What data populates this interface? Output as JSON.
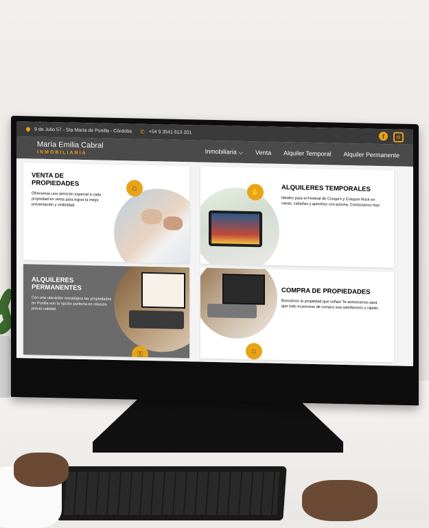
{
  "topbar": {
    "address": "9 de Julio 57 - Sta María de Punilla - Córdoba",
    "phone": "+54 9 3541 613 201",
    "social": [
      {
        "icon": "facebook-icon"
      },
      {
        "icon": "instagram-icon"
      }
    ]
  },
  "brand": {
    "name": "María Emilia Cabral",
    "subtitle": "INMOBILIARIA"
  },
  "nav": {
    "items": [
      "Inmobiliaria ⌵",
      "Venta",
      "Alquiler Temporal",
      "Alquiler Permanente"
    ]
  },
  "cards": [
    {
      "title": "VENTA DE PROPIEDADES",
      "text": "Ofrecemos una atención especial a cada propiedad en venta para lograr la mejor presentación y visibilidad.",
      "icon": "house-sign-icon"
    },
    {
      "title": "ALQUILERES TEMPORALES",
      "text": "Ideales para el Festival de Cosquín y Cosquín Rock en casas, cabañas y quinchos con piscina. Contactanos hoy!",
      "icon": "handshake-icon"
    },
    {
      "title": "ALQUILERES PERMANENTES",
      "text": "Con una ubicación estratégica las propiedades en Punilla son la opción perfecta en relación precio-calidad.",
      "icon": "key-icon"
    },
    {
      "title": "COMPRA DE PROPIEDADES",
      "text": "Buscamos la propiedad que soñas! Te asesoramos para que todo el proceso de compra sea satisfactorio y rápido.",
      "icon": "home-icon"
    }
  ],
  "colors": {
    "accent": "#e8a316",
    "topbar": "#3a3a3a",
    "navbar": "#4a4a4a",
    "dark_card": "#6b6b6b"
  }
}
